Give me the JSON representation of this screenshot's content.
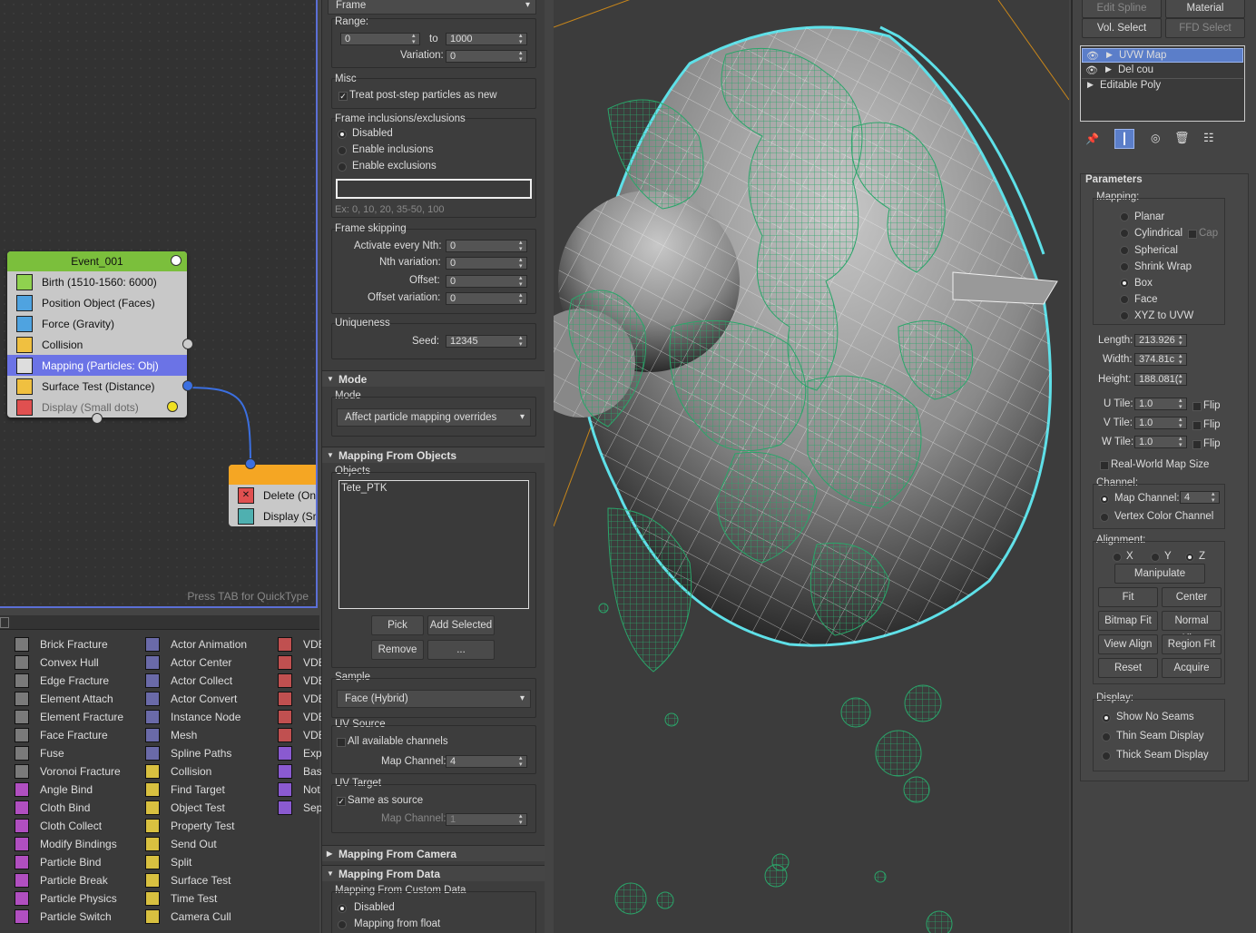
{
  "node_editor": {
    "event_title": "Event_001",
    "operators": [
      {
        "label": "Birth (1510-1560: 6000)",
        "color": "#8fd14f"
      },
      {
        "label": "Position Object (Faces)",
        "color": "#4fa3e0"
      },
      {
        "label": "Force (Gravity)",
        "color": "#4fa3e0"
      },
      {
        "label": "Collision",
        "color": "#f0c040"
      },
      {
        "label": "Mapping (Particles: Obj)",
        "color": "#4fa3e0"
      },
      {
        "label": "Surface Test (Distance)",
        "color": "#f0c040"
      },
      {
        "label": "Display (Small dots)",
        "color": "#e05050"
      }
    ],
    "event2_ops": [
      "Delete (On",
      "Display (Sr"
    ],
    "quicktype_hint": "Press TAB for QuickType"
  },
  "operator_list": {
    "col1": [
      "Brick Fracture",
      "Convex Hull",
      "Edge Fracture",
      "Element Attach",
      "Element Fracture",
      "Face Fracture",
      "Fuse",
      "Voronoi Fracture",
      "Angle Bind",
      "Cloth Bind",
      "Cloth Collect",
      "Modify Bindings",
      "Particle Bind",
      "Particle Break",
      "Particle Physics",
      "Particle Switch"
    ],
    "col2": [
      "Actor Animation",
      "Actor Center",
      "Actor Collect",
      "Actor Convert",
      "Instance Node",
      "Mesh",
      "Spline Paths",
      "Collision",
      "Find Target",
      "Object Test",
      "Property Test",
      "Send Out",
      "Split",
      "Surface Test",
      "Time Test",
      "Camera Cull"
    ],
    "col3": [
      "VDE",
      "VDE",
      "VDE",
      "VDE",
      "VDE",
      "VDE",
      "Exp",
      "Bas",
      "Not",
      "Sep"
    ]
  },
  "params": {
    "frame_dd": "Frame",
    "range_label": "Range:",
    "range_from": "0",
    "range_to_label": "to",
    "range_to": "1000",
    "variation_label": "Variation:",
    "variation": "0",
    "misc_label": "Misc",
    "treat_post_step": "Treat post-step particles as new",
    "frame_incl_label": "Frame inclusions/exclusions",
    "incl_opts": [
      "Disabled",
      "Enable inclusions",
      "Enable exclusions"
    ],
    "frame_example": "Ex: 0, 10, 20, 35-50, 100",
    "frame_skipping_label": "Frame skipping",
    "activate_every_label": "Activate every Nth:",
    "activate_every": "0",
    "nth_variation_label": "Nth variation:",
    "nth_variation": "0",
    "offset_label": "Offset:",
    "offset": "0",
    "offset_var_label": "Offset variation:",
    "offset_var": "0",
    "uniqueness_label": "Uniqueness",
    "seed_label": "Seed:",
    "seed": "12345",
    "mode_rollout": "Mode",
    "mode_label": "Mode",
    "mode_value": "Affect particle mapping overrides",
    "mfo_rollout": "Mapping From Objects",
    "objects_label": "Objects",
    "objects_item": "Tete_PTK",
    "pick": "Pick",
    "add_selected": "Add Selected",
    "remove": "Remove",
    "ellipsis": "...",
    "sample_label": "Sample",
    "sample_value": "Face (Hybrid)",
    "uv_source_label": "UV Source",
    "all_channels": "All available channels",
    "map_channel_label": "Map Channel:",
    "map_channel": "4",
    "uv_target_label": "UV Target",
    "same_as_source": "Same as source",
    "map_channel2_label": "Map Channel:",
    "map_channel2": "1",
    "mfc_rollout": "Mapping From Camera",
    "mfd_rollout": "Mapping From Data",
    "mfcd_label": "Mapping From Custom Data",
    "mfcd_opts": [
      "Disabled",
      "Mapping from float"
    ]
  },
  "command_panel": {
    "btn_edit_spline": "Edit Spline",
    "btn_material": "Material",
    "btn_vol_select": "Vol. Select",
    "btn_ffd_select": "FFD Select",
    "stack": [
      "UVW Map",
      "Del cou",
      "Editable Poly"
    ],
    "parameters_title": "Parameters",
    "mapping_label": "Mapping:",
    "mapping_opts": [
      "Planar",
      "Cylindrical",
      "Spherical",
      "Shrink Wrap",
      "Box",
      "Face",
      "XYZ to UVW"
    ],
    "cap_label": "Cap",
    "length_label": "Length:",
    "length": "213.926",
    "width_label": "Width:",
    "width": "374.81c",
    "height_label": "Height:",
    "height": "188.081(",
    "utile_label": "U Tile:",
    "utile": "1.0",
    "vtile_label": "V Tile:",
    "vtile": "1.0",
    "wtile_label": "W Tile:",
    "wtile": "1.0",
    "flip": "Flip",
    "real_world": "Real-World Map Size",
    "channel_label": "Channel:",
    "map_channel_label": "Map Channel:",
    "map_channel": "4",
    "vertex_color": "Vertex Color Channel",
    "alignment_label": "Alignment:",
    "axes": [
      "X",
      "Y",
      "Z"
    ],
    "manipulate": "Manipulate",
    "fit": "Fit",
    "center": "Center",
    "bitmap_fit": "Bitmap Fit",
    "normal_align": "Normal Align",
    "view_align": "View Align",
    "region_fit": "Region Fit",
    "reset": "Reset",
    "acquire": "Acquire",
    "display_label": "Display:",
    "display_opts": [
      "Show No Seams",
      "Thin Seam Display",
      "Thick Seam Display"
    ]
  }
}
